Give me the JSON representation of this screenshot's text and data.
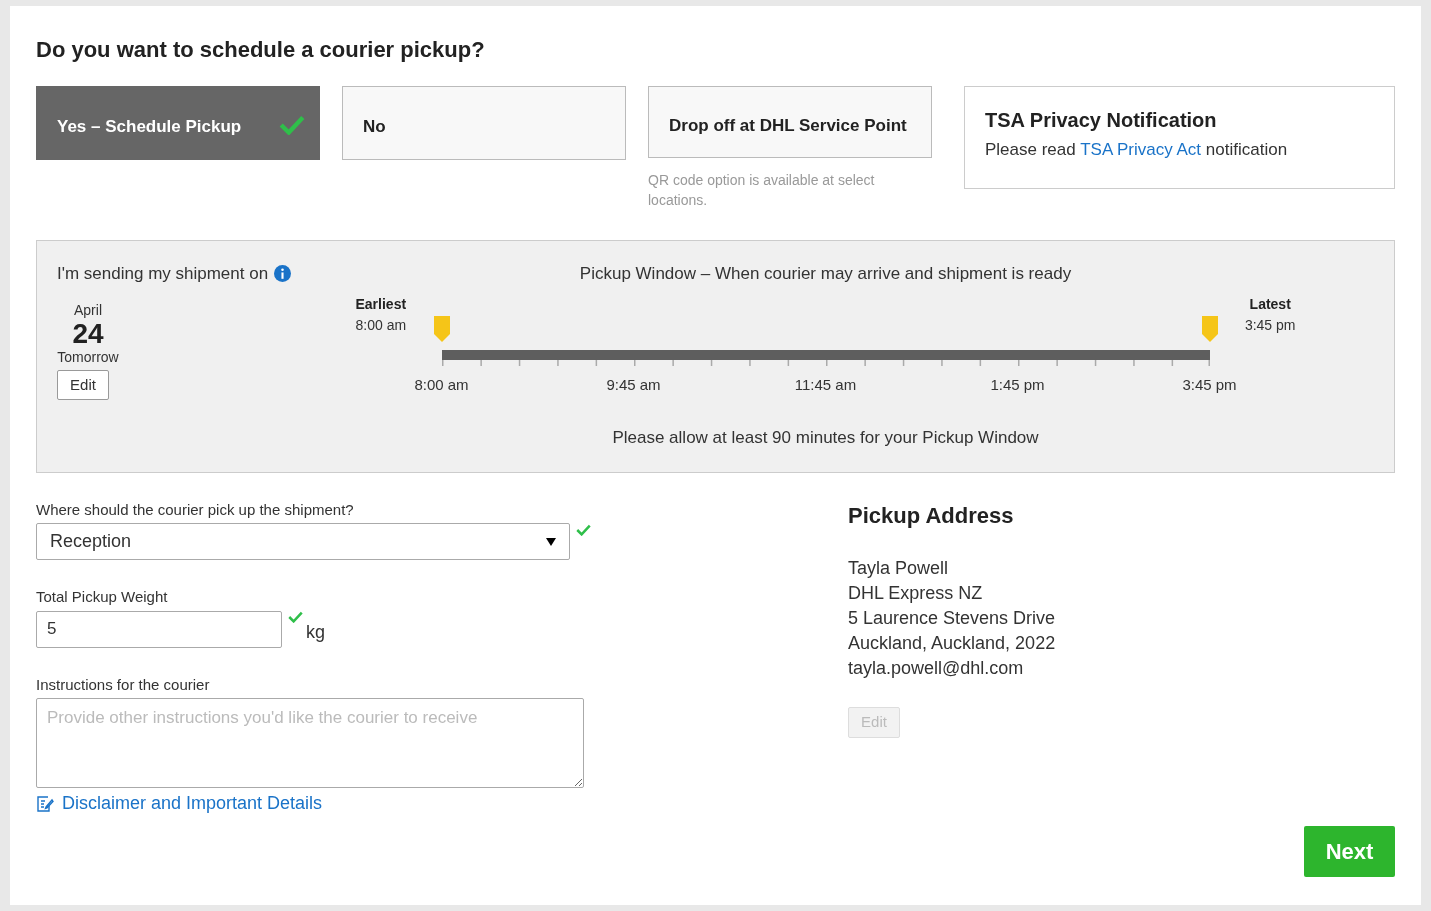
{
  "heading": "Do you want to schedule a courier pickup?",
  "options": [
    {
      "label": "Yes – Schedule Pickup",
      "selected": true
    },
    {
      "label": "No",
      "selected": false
    },
    {
      "label": "Drop off at DHL Service Point",
      "selected": false,
      "note": "QR code option is available at select locations."
    }
  ],
  "tsa": {
    "title": "TSA Privacy Notification",
    "before": "Please read",
    "link": "TSA Privacy Act",
    "after": "notification"
  },
  "schedule": {
    "label": "I'm sending my shipment on",
    "month": "April",
    "day": "24",
    "relative": "Tomorrow",
    "edit": "Edit",
    "window_title": "Pickup Window – When courier may arrive and shipment is ready",
    "handles": [
      {
        "label": "Earliest",
        "time": "8:00 am",
        "level": 0
      },
      {
        "label": "Latest",
        "time": "3:45 pm",
        "level": 1
      }
    ],
    "ticks": [
      "8:00 am",
      "9:45 am",
      "11:45 am",
      "1:45 pm",
      "3:45 pm"
    ],
    "note": "Please allow at least 90 minutes for your Pickup Window"
  },
  "location": {
    "label": "Where should the courier pick up the shipment?",
    "value": "Reception",
    "valid": true
  },
  "weight": {
    "label": "Total Pickup Weight",
    "value": "5",
    "unit": "kg",
    "valid": true
  },
  "instructions": {
    "label": "Instructions for the courier",
    "placeholder": "Provide other instructions you'd like the courier to receive"
  },
  "disclaimer": "Disclaimer and Important Details",
  "address": {
    "title": "Pickup Address",
    "lines": [
      "Tayla Powell",
      "DHL Express NZ",
      "5 Laurence Stevens Drive",
      "Auckland, Auckland, 2022",
      "tayla.powell@dhl.com"
    ],
    "edit": "Edit",
    "edit_disabled": true
  },
  "next": "Next"
}
